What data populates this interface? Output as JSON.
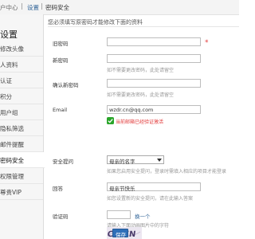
{
  "breadcrumb": {
    "home": "户中心",
    "separator": "|",
    "settings": "设置",
    "current": "密码安全"
  },
  "sidebar": {
    "title": "设置",
    "items": [
      {
        "label": "修改头像",
        "active": false
      },
      {
        "label": "人资料",
        "active": false
      },
      {
        "label": "认证",
        "active": false
      },
      {
        "label": "积分",
        "active": false
      },
      {
        "label": "用户组",
        "active": false
      },
      {
        "label": "隐私筛选",
        "active": false
      },
      {
        "label": "邮件提醒",
        "active": false
      },
      {
        "label": "密码安全",
        "active": true
      },
      {
        "label": "权限管理",
        "active": false
      },
      {
        "label": "尊贵VIP",
        "active": false
      }
    ]
  },
  "notice": "您必须填写原密码才能修改下面的资料",
  "form": {
    "old_password": {
      "label": "旧密码",
      "value": "",
      "required_mark": "*"
    },
    "new_password": {
      "label": "新密码",
      "value": "",
      "hint": "如不需要更改密码，此处请留空"
    },
    "confirm_password": {
      "label": "确认新密码",
      "value": "",
      "hint": "如不需要更改密码，此处请留空"
    },
    "email": {
      "label": "Email",
      "value": "wzdr.cn@qq.com",
      "status": "当前邮箱已经验证激活"
    },
    "security_question": {
      "label": "安全提问",
      "selected": "母亲的名字",
      "hint": "如果您启用安全提问，登录时需填入相应的项目才能登录"
    },
    "answer": {
      "label": "回答",
      "value": "母亲节快乐",
      "hint": "如您设置新的安全提问，请在此输入答案"
    },
    "captcha": {
      "label": "验证码",
      "value": "",
      "swap_link": "换一个",
      "hint": "请输入下面动画图片中的字符",
      "image_text": "CPWN"
    },
    "submit_label": "保存"
  },
  "colors": {
    "accent": "#2f6fb8",
    "required": "#e23a3a",
    "success": "#2aa52a",
    "link": "#336699"
  }
}
